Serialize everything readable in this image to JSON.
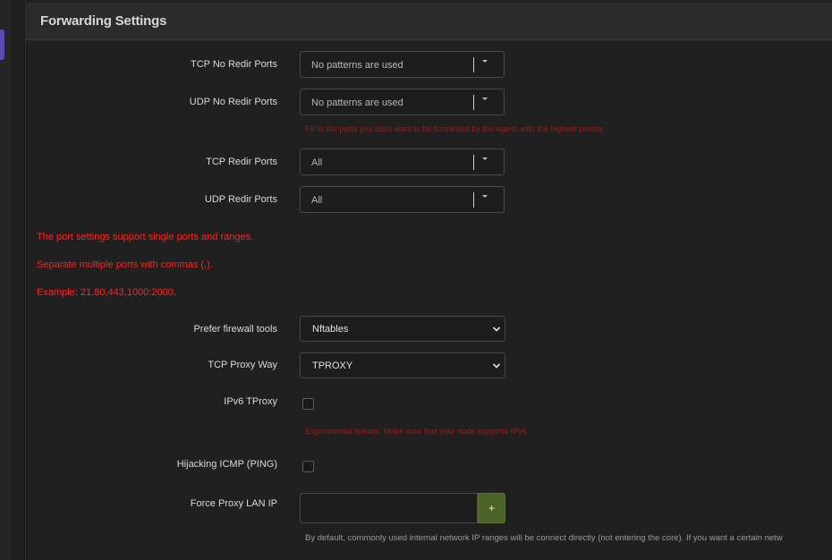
{
  "panel": {
    "title": "Forwarding Settings"
  },
  "tcp_no_redir": {
    "label": "TCP No Redir Ports",
    "value": "No patterns are used"
  },
  "udp_no_redir": {
    "label": "UDP No Redir Ports",
    "value": "No patterns are used"
  },
  "no_redir_hint": "Fill in the ports you don't want to be forwarded by the agent, with the highest priority.",
  "tcp_redir": {
    "label": "TCP Redir Ports",
    "value": "All"
  },
  "udp_redir": {
    "label": "UDP Redir Ports",
    "value": "All"
  },
  "notes": [
    "The port settings support single ports and ranges.",
    "Separate multiple ports with commas (,).",
    "Example: 21,80,443,1000:2000."
  ],
  "firewall": {
    "label": "Prefer firewall tools",
    "value": "Nftables"
  },
  "tcp_proxy_way": {
    "label": "TCP Proxy Way",
    "value": "TPROXY"
  },
  "ipv6_tproxy": {
    "label": "IPv6 TProxy",
    "checked": false,
    "hint": "Experimental feature. Make sure that your node supports IPv6."
  },
  "hijack_icmp": {
    "label": "Hijacking ICMP (PING)",
    "checked": false
  },
  "force_proxy_lan": {
    "label": "Force Proxy LAN IP",
    "value": "",
    "add_label": "+"
  },
  "force_proxy_desc": "By default, commonly used internal network IP ranges will be connect directly (not entering the core). If you want a certain netw",
  "icons": {
    "dropdown": "caret-down-icon",
    "chevron": "chevron-down-icon"
  }
}
